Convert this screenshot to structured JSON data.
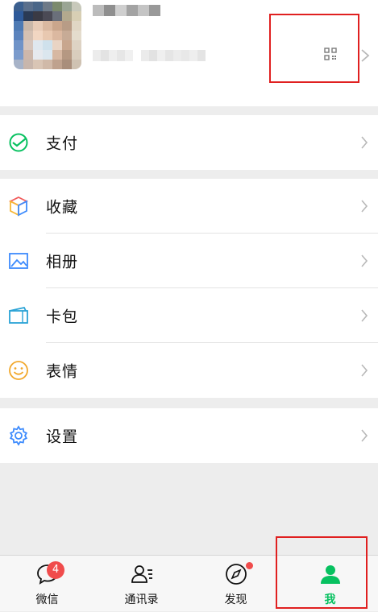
{
  "colors": {
    "accent": "#07c160",
    "badge": "#f04c4c",
    "highlight_box": "#e02020",
    "background": "#ededed"
  },
  "profile": {
    "qr_icon": "qr-code-icon",
    "arrow_icon": "chevron-right-icon"
  },
  "menu": {
    "pay": {
      "label": "支付",
      "icon": "pay-icon"
    },
    "favorites": {
      "label": "收藏",
      "icon": "favorites-cube-icon"
    },
    "album": {
      "label": "相册",
      "icon": "album-image-icon"
    },
    "cards": {
      "label": "卡包",
      "icon": "card-wallet-icon"
    },
    "stickers": {
      "label": "表情",
      "icon": "smiley-icon"
    },
    "settings": {
      "label": "设置",
      "icon": "gear-icon"
    }
  },
  "tabbar": {
    "chats": {
      "label": "微信",
      "badge": "4",
      "icon": "chat-bubble-icon"
    },
    "contacts": {
      "label": "通讯录",
      "icon": "contacts-icon"
    },
    "discover": {
      "label": "发现",
      "icon": "compass-icon"
    },
    "me": {
      "label": "我",
      "icon": "person-icon",
      "active": true
    }
  }
}
